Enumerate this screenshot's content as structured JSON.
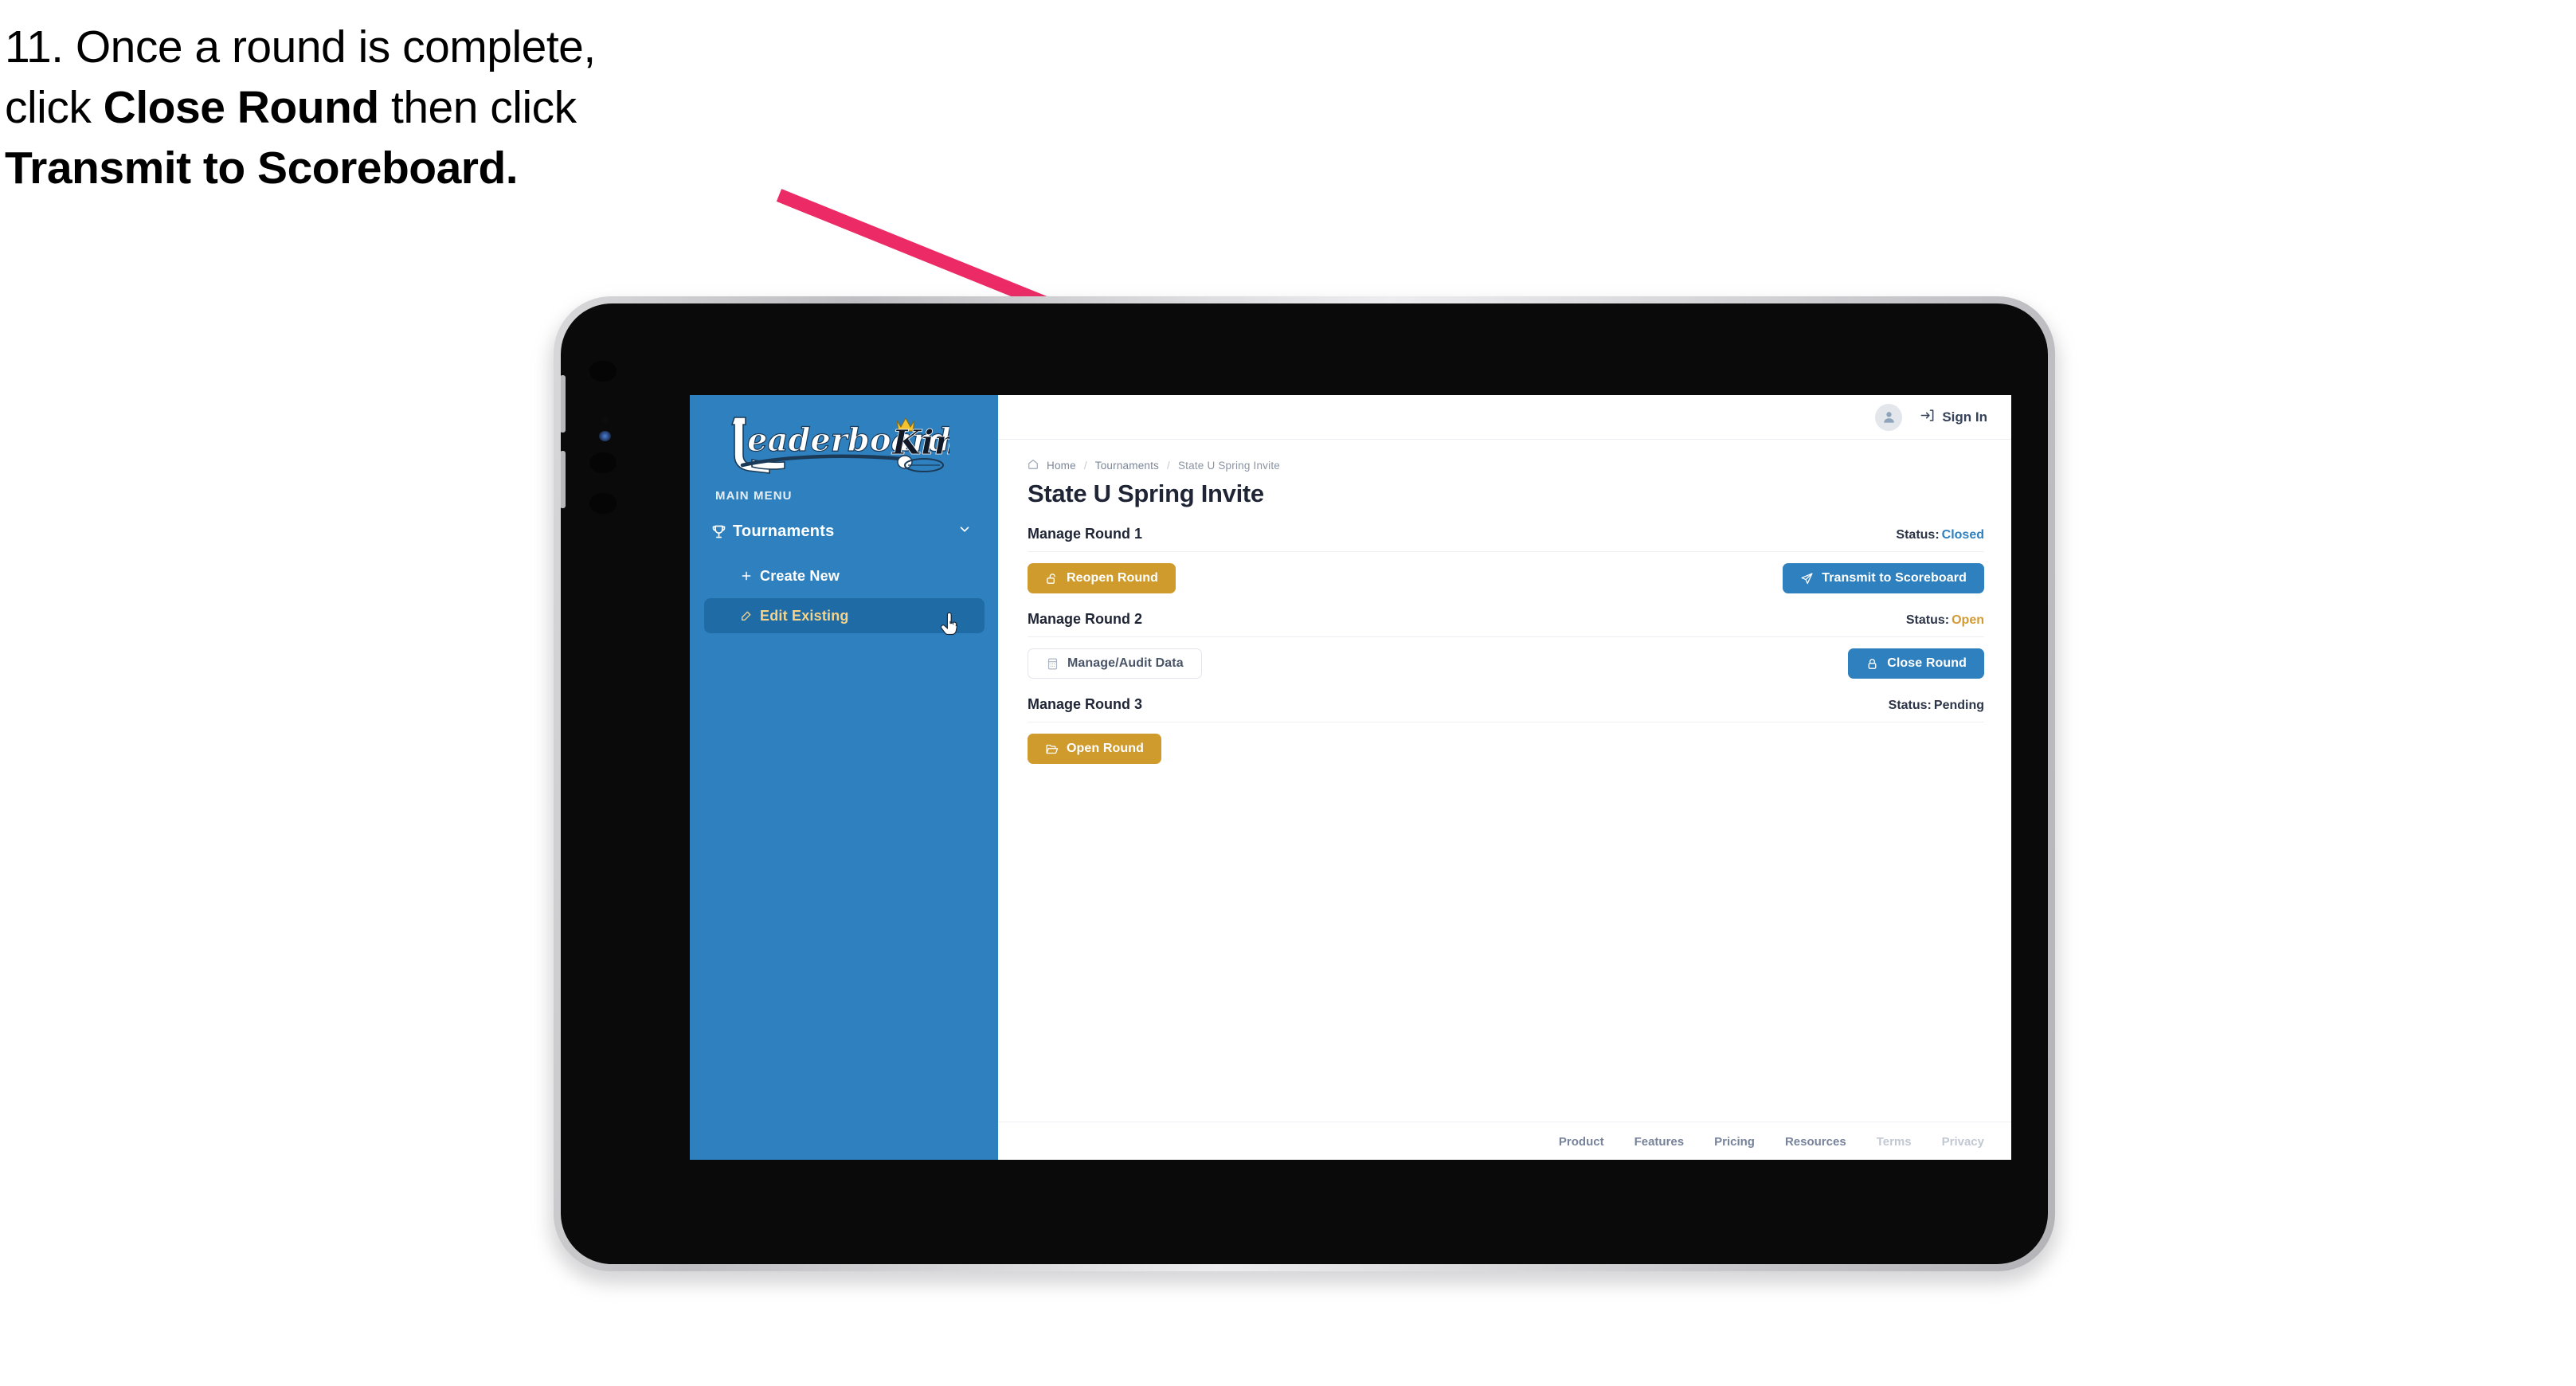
{
  "annotation": {
    "step_number": "11.",
    "line1_prefix": "11. Once a round is complete,",
    "line2_pre": "click ",
    "line2_bold": "Close Round",
    "line2_post": " then click",
    "line3_bold": "Transmit to Scoreboard.",
    "arrow_color": "#ec2a66"
  },
  "app": {
    "sidebar": {
      "brand_primary": "Leaderboard",
      "brand_secondary": "King",
      "section_label": "MAIN MENU",
      "bg_color": "#2F80BF",
      "active_bg_color": "#1F6BA6",
      "active_text_color": "#F5D38A",
      "nav": [
        {
          "label": "Tournaments",
          "icon": "trophy-icon",
          "expanded": true,
          "chevron": "chevron-down-icon"
        }
      ],
      "subnav": [
        {
          "label": "Create New",
          "icon": "plus-icon",
          "active": false
        },
        {
          "label": "Edit Existing",
          "icon": "pencil-square-icon",
          "active": true
        }
      ],
      "cursor": "pointing-hand-cursor"
    },
    "topbar": {
      "avatar_icon": "user-avatar-icon",
      "signin_icon": "sign-in-arrow-icon",
      "signin_label": "Sign In"
    },
    "breadcrumb": {
      "home_icon": "home-icon",
      "items": [
        "Home",
        "Tournaments",
        "State U Spring Invite"
      ],
      "separator": "/"
    },
    "page_title": "State U Spring Invite",
    "status_colors": {
      "closed": "#2F80BF",
      "open": "#D39A33",
      "pending": "#2C3448"
    },
    "rounds": [
      {
        "title": "Manage Round 1",
        "status_label": "Status:",
        "status_value": "Closed",
        "status_state": "closed",
        "left_button": {
          "label": "Reopen Round",
          "icon": "unlock-icon",
          "style": "gold"
        },
        "right_button": {
          "label": "Transmit to Scoreboard",
          "icon": "paper-plane-icon",
          "style": "blue"
        }
      },
      {
        "title": "Manage Round 2",
        "status_label": "Status:",
        "status_value": "Open",
        "status_state": "open",
        "left_button": {
          "label": "Manage/Audit Data",
          "icon": "spreadsheet-icon",
          "style": "ghost"
        },
        "right_button": {
          "label": "Close Round",
          "icon": "lock-icon",
          "style": "blue"
        }
      },
      {
        "title": "Manage Round 3",
        "status_label": "Status:",
        "status_value": "Pending",
        "status_state": "pending",
        "left_button": {
          "label": "Open Round",
          "icon": "open-folder-icon",
          "style": "gold"
        },
        "right_button": null
      }
    ],
    "footer": {
      "links": [
        {
          "label": "Product",
          "muted": false
        },
        {
          "label": "Features",
          "muted": false
        },
        {
          "label": "Pricing",
          "muted": false
        },
        {
          "label": "Resources",
          "muted": false
        },
        {
          "label": "Terms",
          "muted": true
        },
        {
          "label": "Privacy",
          "muted": true
        }
      ]
    }
  }
}
